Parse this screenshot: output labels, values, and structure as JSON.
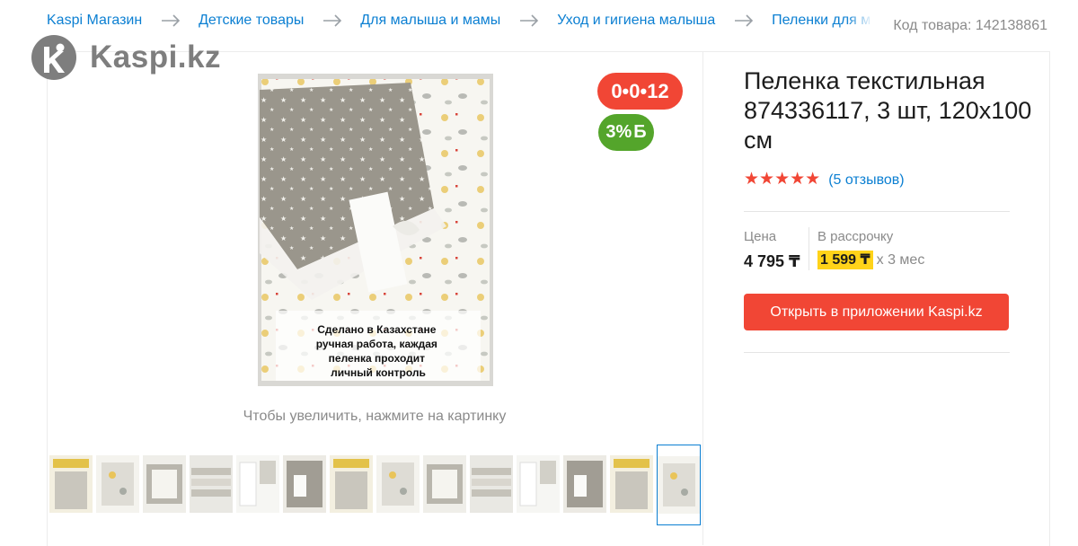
{
  "breadcrumbs": [
    "Kaspi Магазин",
    "Детские товары",
    "Для малыша и мамы",
    "Уход и гигиена малыша",
    "Пеленки для м"
  ],
  "product_code": "Код товара: 142138861",
  "logo": {
    "text": "Kaspi.kz",
    "icon": "kaspi-logo-icon"
  },
  "badges": {
    "installment": "0•0•12",
    "bonus_percent": "3%",
    "bonus_symbol": "Б"
  },
  "image": {
    "overlay_text": [
      "Сделано в Казахстане",
      "ручная работа, каждая",
      "пеленка проходит",
      "личный контроль"
    ],
    "zoom_hint": "Чтобы увеличить, нажмите на картинку"
  },
  "thumbnails": {
    "count": 14,
    "active_index": 13
  },
  "product": {
    "title": "Пеленка текстильная 874336117, 3 шт, 120x100 см",
    "stars": "★★★★★",
    "rating_value": 5,
    "reviews": "(5 отзывов)"
  },
  "price": {
    "label": "Цена",
    "value": "4 795 ₸"
  },
  "installment": {
    "label": "В рассрочку",
    "amount": "1 599 ₸",
    "term": "x 3 мес"
  },
  "actions": {
    "open_app": "Открыть в приложении Kaspi.kz"
  },
  "colors": {
    "brand_red": "#f14635",
    "link_blue": "#0b7fd2",
    "bonus_green": "#54a52b",
    "highlight_yellow": "#ffd319"
  }
}
